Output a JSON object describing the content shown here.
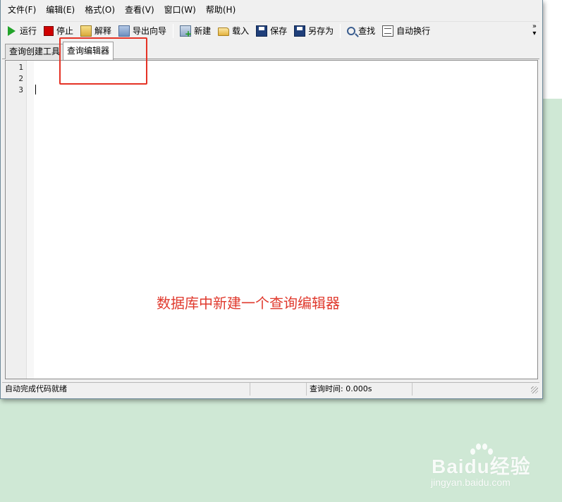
{
  "menu": {
    "items": [
      "文件(F)",
      "编辑(E)",
      "格式(O)",
      "查看(V)",
      "窗口(W)",
      "帮助(H)"
    ]
  },
  "toolbar": {
    "run": "运行",
    "stop": "停止",
    "explain": "解释",
    "export_wizard": "导出向导",
    "new": "新建",
    "load": "载入",
    "save": "保存",
    "save_as": "另存为",
    "find": "查找",
    "word_wrap": "自动换行",
    "more": "»"
  },
  "tabs": [
    {
      "label": "查询创建工具"
    },
    {
      "label": "查询编辑器"
    }
  ],
  "editor": {
    "line_numbers": [
      "1",
      "2",
      "3"
    ]
  },
  "annotation": "数据库中新建一个查询编辑器",
  "status": {
    "autocomplete": "自动完成代码就绪",
    "query_time": "查询时间: 0.000s"
  },
  "watermark": {
    "logo": "Baidu经验",
    "url": "jingyan.baidu.com"
  }
}
